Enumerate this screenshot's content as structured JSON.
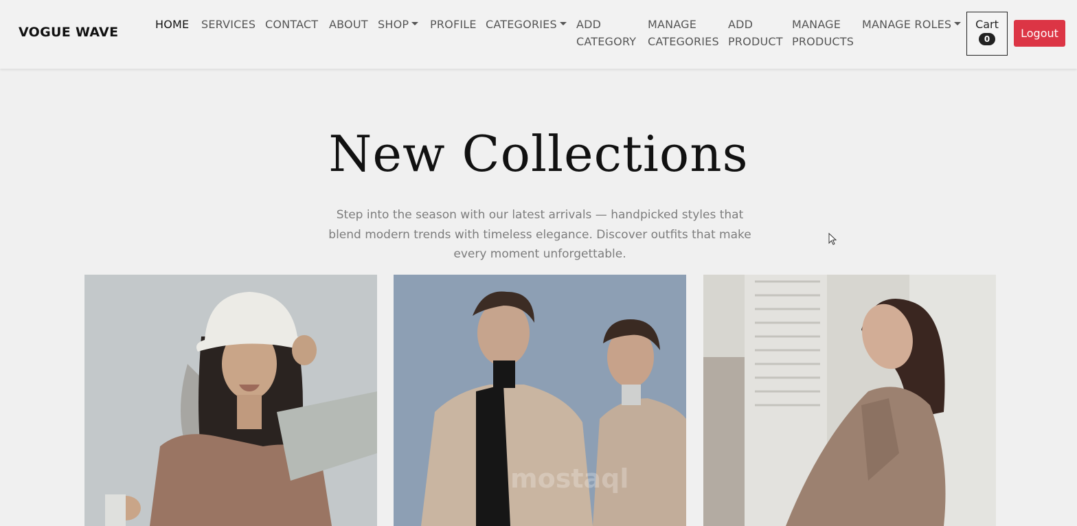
{
  "brand": "VOGUE WAVE",
  "nav": {
    "home": "HOME",
    "services": "SERVICES",
    "contact": "CONTACT",
    "about": "ABOUT",
    "shop": "SHOP",
    "profile": "PROFILE",
    "categories": "CATEGORIES",
    "add_category_1": "ADD",
    "add_category_2": "CATEGORY",
    "manage_categories_1": "MANAGE",
    "manage_categories_2": "CATEGORIES",
    "add_product_1": "ADD",
    "add_product_2": "PRODUCT",
    "manage_products_1": "MANAGE",
    "manage_products_2": "PRODUCTS",
    "manage_roles": "MANAGE ROLES"
  },
  "cart": {
    "label": "Cart",
    "count": "0"
  },
  "logout": "Logout",
  "hero": {
    "title": "New Collections",
    "subtitle": "Step into the season with our latest arrivals — handpicked styles that blend modern trends with timeless elegance. Discover outfits that make every moment unforgettable."
  },
  "colors": {
    "background": "#f0f0f0",
    "logout_button": "#dc3545",
    "cart_badge": "#222222"
  },
  "collection_images": [
    {
      "name": "woman-in-white-bucket-hat"
    },
    {
      "name": "two-women-in-beige-trench-coats"
    },
    {
      "name": "woman-in-plaid-blazer"
    }
  ]
}
